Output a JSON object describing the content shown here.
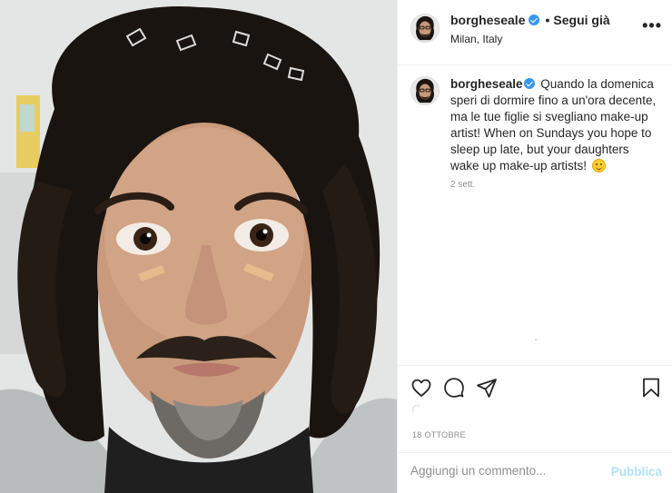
{
  "post": {
    "header": {
      "username": "borgheseale",
      "verified_icon": "verified-badge-icon",
      "separator": "•",
      "follow_label": "Segui già",
      "location": "Milan, Italy",
      "more_label": "•••"
    },
    "caption": {
      "username": "borgheseale",
      "text": "Quando la domenica speri di dormire fino a un'ora decente, ma le tue figlie si svegliano make-up artist! When on Sundays you hope to sleep up late, but your daughters wake up make-up artists!",
      "emoji": "smiling-face-emoji",
      "time": "2 sett."
    },
    "actions": {
      "icons": [
        "heart-icon",
        "comment-icon",
        "share-icon",
        "bookmark-icon"
      ]
    },
    "date": "18 OTTOBRE",
    "comment_box": {
      "placeholder": "Aggiungi un commento...",
      "publish_label": "Pubblica"
    },
    "colors": {
      "verified": "#3897f0",
      "publish_disabled": "#b2dffc",
      "muted_text": "#8e8e8e",
      "text": "#262626",
      "border": "#efefef"
    }
  }
}
